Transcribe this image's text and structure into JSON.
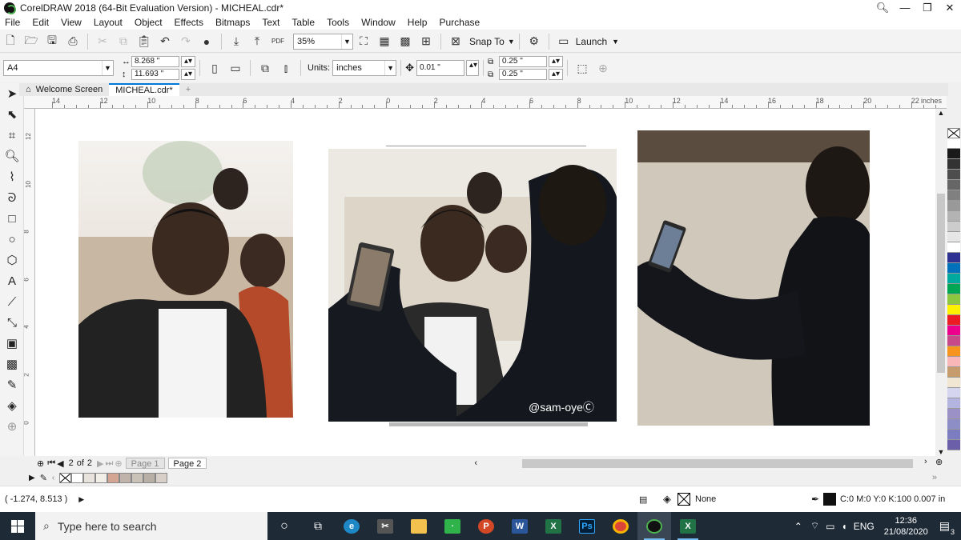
{
  "window": {
    "title": "CorelDRAW 2018 (64-Bit Evaluation Version) - MICHEAL.cdr*",
    "controls": [
      "🔍︎",
      "—",
      "❐",
      "✕"
    ]
  },
  "menu": [
    "File",
    "Edit",
    "View",
    "Layout",
    "Object",
    "Effects",
    "Bitmaps",
    "Text",
    "Table",
    "Tools",
    "Window",
    "Help",
    "Purchase"
  ],
  "toolbar1": {
    "zoom": "35%",
    "snap_label": "Snap To",
    "launch_label": "Launch"
  },
  "toolbar2": {
    "page_size": "A4",
    "width": "8.268 \"",
    "height": "11.693 \"",
    "units_label": "Units:",
    "units_value": "inches",
    "nudge": "0.01 \"",
    "dup_x": "0.25 \"",
    "dup_y": "0.25 \""
  },
  "tabs": {
    "welcome": "Welcome Screen",
    "document": "MICHEAL.cdr*"
  },
  "ruler": {
    "labels": [
      "14",
      "12",
      "10",
      "8",
      "6",
      "4",
      "2",
      "0",
      "2",
      "4",
      "6",
      "8",
      "10",
      "12",
      "14",
      "16",
      "18",
      "20",
      "22"
    ],
    "units": "inches"
  },
  "vruler_labels": [
    "12",
    "10",
    "8",
    "6",
    "4",
    "2",
    "0"
  ],
  "canvas": {
    "watermark": "@sam-oyeⒸ"
  },
  "page_nav": {
    "current": "2",
    "of": "of",
    "total": "2",
    "page1": "Page 1",
    "page2": "Page 2"
  },
  "status": {
    "coords": "( -1.274, 8.513 )",
    "fill_label": "None",
    "outline": "C:0 M:0 Y:0 K:100  0.007 in"
  },
  "taskbar": {
    "search_placeholder": "Type here to search",
    "time": "12:36",
    "date": "21/08/2020",
    "lang": "ENG",
    "notif": "3"
  },
  "palette_colors": [
    "#ffffff",
    "#1a1a1a",
    "#333333",
    "#4d4d4d",
    "#666666",
    "#808080",
    "#999999",
    "#b3b3b3",
    "#cccccc",
    "#e6e6e6",
    "#ffffff",
    "#2e3192",
    "#0072bc",
    "#00a99d",
    "#00a651",
    "#8dc63f",
    "#fff200",
    "#ed1c24",
    "#ec008c",
    "#c7498a",
    "#f7941d",
    "#f9b7b7",
    "#c69c6d",
    "#f0e6d2",
    "#d5d5f0",
    "#b4b4e0",
    "#9c91c7",
    "#8e8ec7",
    "#7c7cc0",
    "#6a5fa8"
  ],
  "doc_swatches": [
    "#ffffff",
    "#e8e2dc",
    "#f2eee8",
    "#d4a593",
    "#bfb3ab",
    "#c9c2b8",
    "#b8b0a6",
    "#d8d0c8"
  ]
}
